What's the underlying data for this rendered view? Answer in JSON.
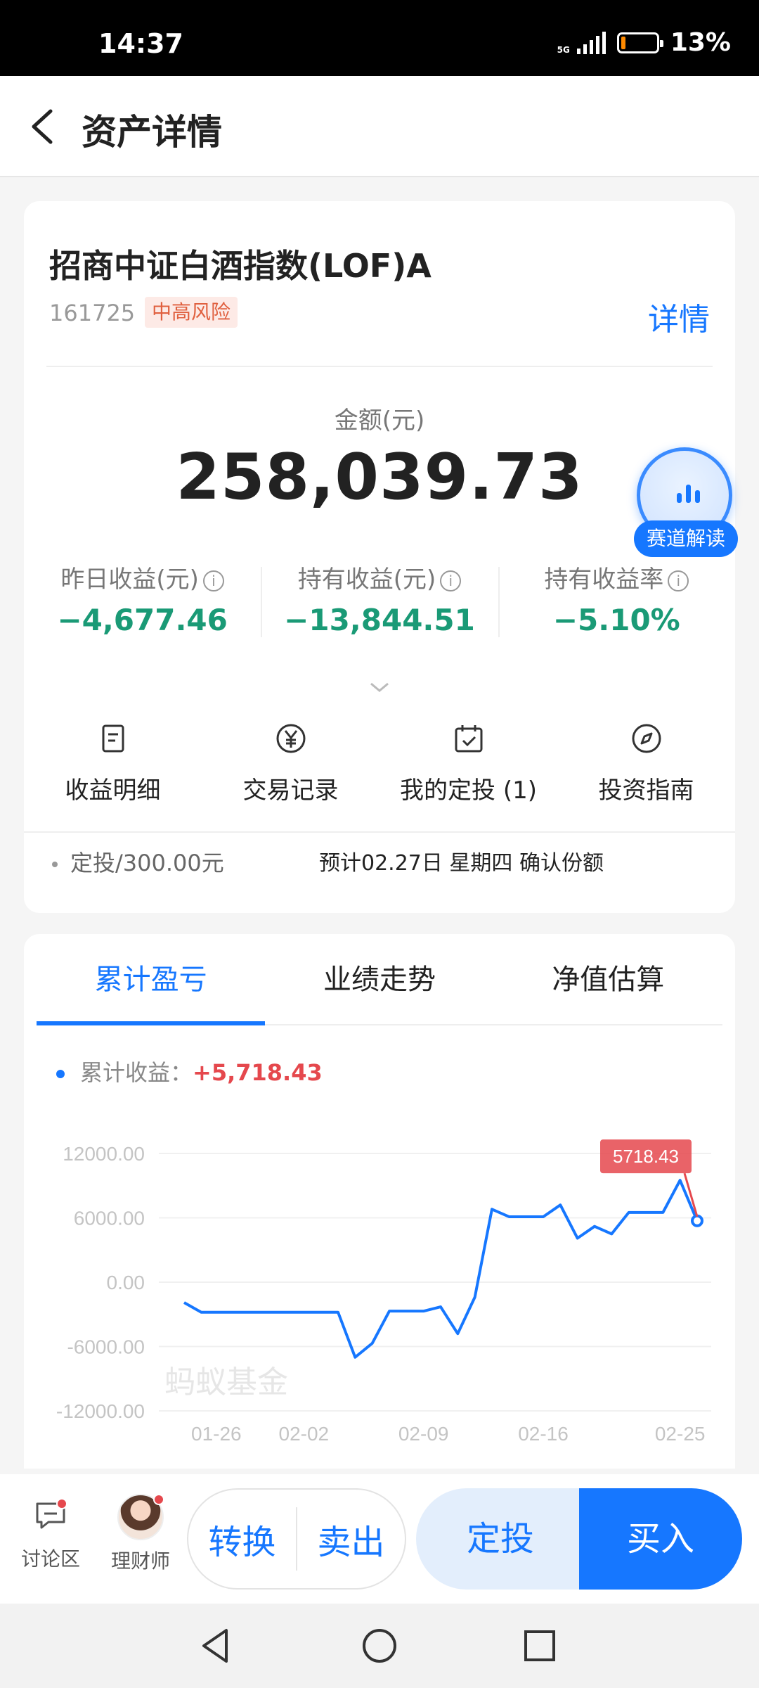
{
  "status": {
    "time": "14:37",
    "network": "5G",
    "battery": "13%",
    "battery_level": 0.13
  },
  "header": {
    "title": "资产详情"
  },
  "fund": {
    "name": "招商中证白酒指数(LOF)A",
    "code": "161725",
    "risk": "中高风险",
    "detail_link": "详情"
  },
  "amount": {
    "label": "金额(元)",
    "value": "258,039.73"
  },
  "analysis": {
    "label": "赛道解读"
  },
  "stats": [
    {
      "label": "昨日收益(元)",
      "value": "−4,677.46"
    },
    {
      "label": "持有收益(元)",
      "value": "−13,844.51"
    },
    {
      "label": "持有收益率",
      "value": "−5.10%"
    }
  ],
  "actions": [
    {
      "label": "收益明细",
      "icon": "document-icon"
    },
    {
      "label": "交易记录",
      "icon": "yen-icon"
    },
    {
      "label": "我的定投 (1)",
      "icon": "calendar-check-icon"
    },
    {
      "label": "投资指南",
      "icon": "compass-icon"
    }
  ],
  "plan": {
    "text": "定投/300.00元",
    "note": "预计02.27日 星期四 确认份额"
  },
  "tabs": [
    {
      "label": "累计盈亏",
      "active": true
    },
    {
      "label": "业绩走势",
      "active": false
    },
    {
      "label": "净值估算",
      "active": false
    }
  ],
  "cumulative": {
    "label": "累计收益：",
    "value": "+5,718.43"
  },
  "chart_data": {
    "type": "line",
    "title": "",
    "xlabel": "",
    "ylabel": "",
    "ylim": [
      -12000,
      12000
    ],
    "yticks": [
      "12000.00",
      "6000.00",
      "0.00",
      "-6000.00",
      "-12000.00"
    ],
    "xtick_labels": [
      "01-26",
      "02-02",
      "02-09",
      "02-16",
      "02-25"
    ],
    "watermark": "蚂蚁基金",
    "last_label": "5718.43",
    "grid": true,
    "series": [
      {
        "color": "#1677ff",
        "values": [
          -1900,
          -2800,
          -2800,
          -2800,
          -2800,
          -2800,
          -2800,
          -2800,
          -2800,
          -2800,
          -7000,
          -5700,
          -2700,
          -2700,
          -2700,
          -2300,
          -4800,
          -1400,
          6800,
          6100,
          6100,
          6100,
          7200,
          4100,
          5200,
          4500,
          6500,
          6500,
          6500,
          9500,
          5718.43
        ]
      }
    ]
  },
  "bottom": {
    "discussion": "讨论区",
    "advisor": "理财师",
    "convert": "转换",
    "sell": "卖出",
    "plan": "定投",
    "buy": "买入"
  },
  "colors": {
    "accent": "#1677ff",
    "loss": "#1a9a76",
    "gain": "#e5484d"
  }
}
